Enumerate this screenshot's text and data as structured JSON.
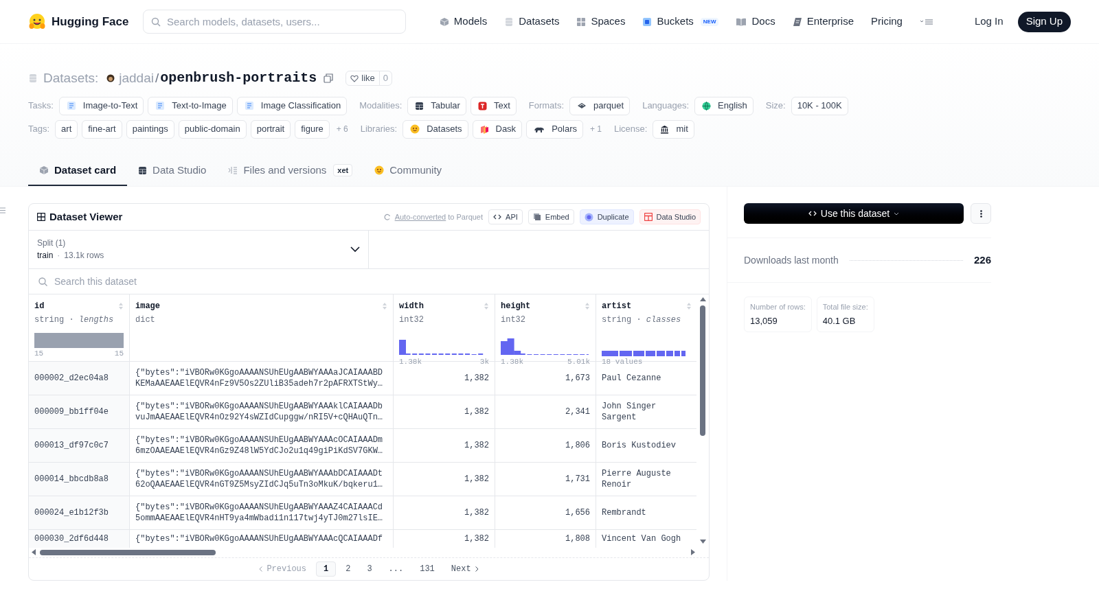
{
  "header": {
    "brand": "Hugging Face",
    "search_placeholder": "Search models, datasets, users...",
    "nav": [
      {
        "label": "Models",
        "kind": "cube"
      },
      {
        "label": "Datasets",
        "kind": "db"
      },
      {
        "label": "Spaces",
        "kind": "grid"
      },
      {
        "label": "Buckets",
        "kind": "bucket",
        "badge": "NEW"
      },
      {
        "label": "Docs",
        "kind": "book"
      },
      {
        "label": "Enterprise",
        "kind": "enterprise"
      },
      {
        "label": "Pricing",
        "kind": "none"
      }
    ],
    "login": "Log In",
    "signup": "Sign Up"
  },
  "repo": {
    "section": "Datasets:",
    "owner": "jaddai",
    "separator": "/",
    "name": "openbrush-portraits",
    "like_label": "like",
    "like_count": "0"
  },
  "meta_rows": [
    [
      {
        "label": "Tasks:",
        "chips": [
          {
            "text": "Image-to-Text",
            "kind": "doc"
          },
          {
            "text": "Text-to-Image",
            "kind": "doc"
          },
          {
            "text": "Image Classification",
            "kind": "doc"
          }
        ]
      },
      {
        "label": "Modalities:",
        "chips": [
          {
            "text": "Tabular",
            "kind": "table"
          },
          {
            "text": "Text",
            "kind": "text"
          }
        ]
      },
      {
        "label": "Formats:",
        "chips": [
          {
            "text": "parquet",
            "kind": "parquet"
          }
        ]
      },
      {
        "label": "Languages:",
        "chips": [
          {
            "text": "English",
            "kind": "globe"
          }
        ]
      },
      {
        "label": "Size:",
        "chips": [
          {
            "text": "10K - 100K",
            "kind": "none"
          }
        ]
      }
    ],
    [
      {
        "label": "Tags:",
        "chips": [
          {
            "text": "art",
            "kind": "none"
          },
          {
            "text": "fine-art",
            "kind": "none"
          },
          {
            "text": "paintings",
            "kind": "none"
          },
          {
            "text": "public-domain",
            "kind": "none"
          },
          {
            "text": "portrait",
            "kind": "none"
          },
          {
            "text": "figure",
            "kind": "none"
          }
        ],
        "more": "+ 6"
      },
      {
        "label": "Libraries:",
        "chips": [
          {
            "text": "Datasets",
            "kind": "smiley"
          },
          {
            "text": "Dask",
            "kind": "dask"
          },
          {
            "text": "Polars",
            "kind": "bear"
          }
        ],
        "more": "+ 1"
      },
      {
        "label": "License:",
        "chips": [
          {
            "text": "mit",
            "kind": "bank"
          }
        ]
      }
    ]
  ],
  "tabs": [
    {
      "label": "Dataset card",
      "kind": "cube",
      "selected": true
    },
    {
      "label": "Data Studio",
      "kind": "table",
      "selected": false
    },
    {
      "label": "Files and versions",
      "kind": "files",
      "selected": false,
      "badge": "xet"
    },
    {
      "label": "Community",
      "kind": "smiley",
      "selected": false
    }
  ],
  "viewer": {
    "title": "Dataset Viewer",
    "auto_link": "Auto-converted",
    "auto_rest": "to Parquet",
    "buttons": [
      {
        "label": "API",
        "kind": "code"
      },
      {
        "label": "Embed",
        "kind": "embed"
      },
      {
        "label": "Duplicate",
        "kind": "duplicate"
      },
      {
        "label": "Data Studio",
        "kind": "studio"
      }
    ],
    "split": {
      "label": "Split (1)",
      "name": "train",
      "separator": "·",
      "rows": "13.1k rows"
    },
    "search_placeholder": "Search this dataset",
    "columns": [
      {
        "name": "id",
        "type": "string · *lengths*",
        "kind": "solid",
        "min": "15",
        "max": "15"
      },
      {
        "name": "image",
        "type": "dict",
        "kind": "none"
      },
      {
        "name": "width",
        "type": "int32",
        "kind": "hist_a",
        "min": "1.38k",
        "max": "3k"
      },
      {
        "name": "height",
        "type": "int32",
        "kind": "hist_b",
        "min": "1.38k",
        "max": "5.01k"
      },
      {
        "name": "artist",
        "type": "string · *classes*",
        "kind": "classes",
        "min": "18 values"
      }
    ],
    "rows": [
      [
        "000002_d2ec04a8",
        "{\"bytes\":\"iVBORw0KGgoAAAANSUhEUgAABWYAAAaJCAIAAABD\nKEMaAAEAAElEQVR4nFz9V5Os2ZUliB35adeh7r2pAFRXTStWy…",
        "1,382",
        "1,673",
        "Paul Cezanne"
      ],
      [
        "000009_bb1ff04e",
        "{\"bytes\":\"iVBORw0KGgoAAAANSUhEUgAABWYAAAklCAIAAADb\nvuJmAAEAAElEQVR4nOz92Y4sWZIdCupggw/nRI5V+cQHAuQTn…",
        "1,382",
        "2,341",
        "John Singer Sargent"
      ],
      [
        "000013_df97c0c7",
        "{\"bytes\":\"iVBORw0KGgoAAAANSUhEUgAABWYAAAcOCAIAAADm\n6mzOAAEAAElEQVR4nGz9Z48lW5YdCJo2u1q49giPiKdSV7GKW…",
        "1,382",
        "1,806",
        "Boris Kustodiev"
      ],
      [
        "000014_bbcdb8a8",
        "{\"bytes\":\"iVBORw0KGgoAAAANSUhEUgAABWYAAAbDCAIAAADt\n62oQAAEAAElEQVR4nGT9Z5MsyZIdCJq5uTn3oMkuK/bqkeru1…",
        "1,382",
        "1,731",
        "Pierre Auguste Renoir"
      ],
      [
        "000024_e1b12f3b",
        "{\"bytes\":\"iVBORw0KGgoAAAANSUhEUgAABWYAAAZ4CAIAAACd\n5ommAAEAAElEQVR4nHT9ya4mWbadi1n117twj4yTJ0m27lsIE…",
        "1,382",
        "1,656",
        "Rembrandt"
      ],
      [
        "000030_2df6d448",
        "{\"bytes\":\"iVBORw0KGgoAAAANSUhEUgAABWYAAAcQCAIAAADf",
        "1,382",
        "1,808",
        "Vincent Van Gogh"
      ]
    ],
    "pagination": {
      "previous": "Previous",
      "pages": [
        {
          "label": "1",
          "selected": true
        },
        {
          "label": "2",
          "selected": false
        },
        {
          "label": "3",
          "selected": false
        },
        {
          "label": "...",
          "selected": false
        },
        {
          "label": "131",
          "selected": false
        }
      ],
      "next": "Next"
    }
  },
  "sidebar": {
    "use_button": "Use this dataset",
    "downloads_label": "Downloads last month",
    "downloads_value": "226",
    "stats": [
      {
        "label": "Number of rows:",
        "value": "13,059"
      },
      {
        "label": "Total file size:",
        "value": "40.1 GB"
      }
    ]
  }
}
